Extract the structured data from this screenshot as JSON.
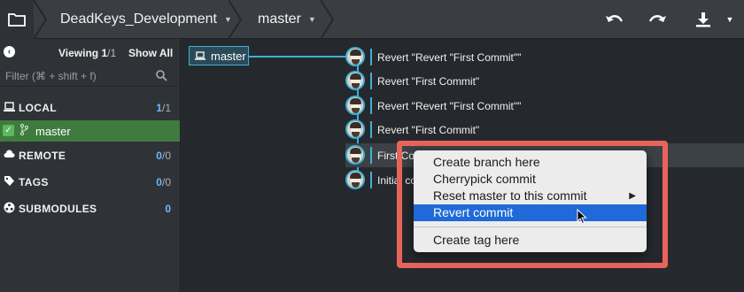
{
  "toolbar": {
    "repo_name": "DeadKeys_Development",
    "branch_name": "master",
    "icons": [
      "folder-icon",
      "undo-icon",
      "redo-icon",
      "download-icon"
    ]
  },
  "sidebar": {
    "viewing_label": "Viewing",
    "viewing_count": "1",
    "viewing_total": "/1",
    "show_all": "Show All",
    "filter_placeholder": "Filter (⌘ + shift + f)",
    "local": {
      "label": "LOCAL",
      "count": "1",
      "total": "/1"
    },
    "local_branch": "master",
    "remote": {
      "label": "REMOTE",
      "count": "0",
      "total": "/0"
    },
    "tags": {
      "label": "TAGS",
      "count": "0",
      "total": "/0"
    },
    "submodules": {
      "label": "SUBMODULES",
      "count": "0"
    }
  },
  "graph": {
    "branch_tag": "master",
    "commits": [
      "Revert \"Revert \"First Commit\"\"",
      "Revert \"First Commit\"",
      "Revert \"Revert \"First Commit\"\"",
      "Revert \"First Commit\"",
      "First Co",
      "Initial co"
    ]
  },
  "context_menu": {
    "items": [
      "Create branch here",
      "Cherrypick commit",
      "Reset master to this commit",
      "Revert commit",
      "Create tag here"
    ],
    "active_item": "Revert commit",
    "submenu_arrow": "▶"
  },
  "colors": {
    "accent": "#3fb0d6",
    "highlight_box": "#e8645a",
    "menu_active": "#1f6ad8",
    "local_branch_bg": "#3f7b3f"
  }
}
